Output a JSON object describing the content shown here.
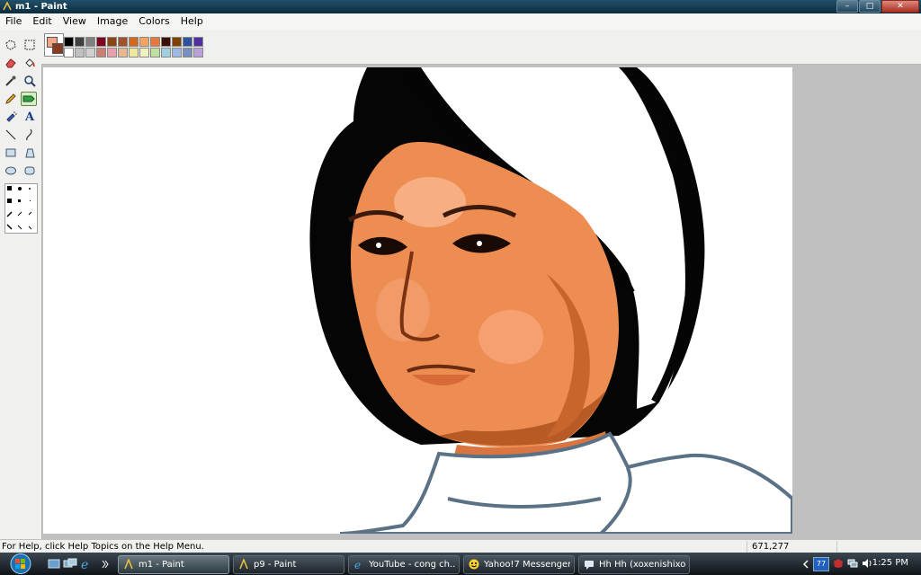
{
  "window": {
    "title": "m1 - Paint"
  },
  "window_buttons": {
    "minimize": "–",
    "maximize": "□",
    "close": "✕"
  },
  "menu": [
    "File",
    "Edit",
    "View",
    "Image",
    "Colors",
    "Help"
  ],
  "tools": [
    {
      "name": "free-form-select-icon",
      "active": false
    },
    {
      "name": "select-icon",
      "active": false
    },
    {
      "name": "eraser-icon",
      "active": false
    },
    {
      "name": "fill-bucket-icon",
      "active": false
    },
    {
      "name": "color-picker-icon",
      "active": false
    },
    {
      "name": "magnifier-icon",
      "active": false
    },
    {
      "name": "pencil-icon",
      "active": false
    },
    {
      "name": "brush-icon",
      "active": true
    },
    {
      "name": "airbrush-icon",
      "active": false
    },
    {
      "name": "text-icon",
      "active": false,
      "glyph": "A"
    },
    {
      "name": "line-icon",
      "active": false
    },
    {
      "name": "curve-icon",
      "active": false
    },
    {
      "name": "rectangle-icon",
      "active": false
    },
    {
      "name": "polygon-icon",
      "active": false
    },
    {
      "name": "ellipse-icon",
      "active": false
    },
    {
      "name": "rounded-rectangle-icon",
      "active": false
    }
  ],
  "colors": {
    "foreground": "#f4a784",
    "background": "#8a3a20",
    "palette_top": [
      "#000000",
      "#404040",
      "#808080",
      "#800020",
      "#8b4513",
      "#a0522d",
      "#d2691e",
      "#f4a460",
      "#e8783c",
      "#3b1008",
      "#804000",
      "#3050a0",
      "#5030a0"
    ],
    "palette_bottom": [
      "#ffffff",
      "#c0c0c0",
      "#d0d0d0",
      "#c88070",
      "#e8a0b0",
      "#e8b890",
      "#f0e8a0",
      "#f0f0c0",
      "#c0e0a0",
      "#a0d0e0",
      "#a0b8e0",
      "#7890c0",
      "#b8a0d8"
    ]
  },
  "status": {
    "help": "For Help, click Help Topics on the Help Menu.",
    "coords": "671,277"
  },
  "taskbar": {
    "buttons": [
      {
        "label": "m1 - Paint",
        "icon": "paint-icon",
        "active": true
      },
      {
        "label": "p9 - Paint",
        "icon": "paint-icon",
        "active": false
      },
      {
        "label": "YouTube - cong ch...",
        "icon": "ie-icon",
        "active": false
      },
      {
        "label": "Yahoo!7 Messenger",
        "icon": "smiley-icon",
        "active": false
      },
      {
        "label": "Hh Hh (xoxenishixox...",
        "icon": "messenger-icon",
        "active": false
      }
    ],
    "tray": {
      "temp": "77",
      "clock": "1:25 PM"
    }
  }
}
